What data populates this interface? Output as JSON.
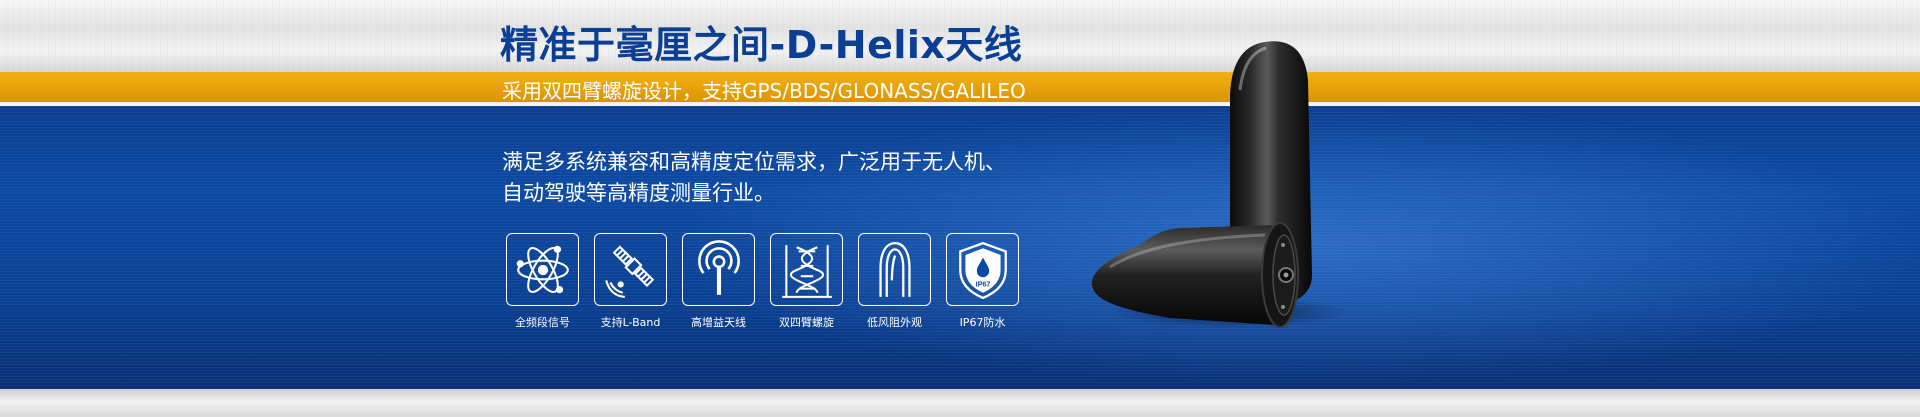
{
  "banner": {
    "title": "精准于毫厘之间-D-Helix天线",
    "subtitle": "采用双四臂螺旋设计，支持GPS/BDS/GLONASS/GALILEO",
    "description_lines": [
      "满足多系统兼容和高精度定位需求，广泛用于无人机、",
      "自动驾驶等高精度测量行业。"
    ],
    "features": [
      {
        "label": "全频段信号",
        "icon": "atom-icon"
      },
      {
        "label": "支持L-Band",
        "icon": "satellite-icon"
      },
      {
        "label": "高增益天线",
        "icon": "antenna-signal-icon"
      },
      {
        "label": "双四臂螺旋",
        "icon": "helix-icon"
      },
      {
        "label": "低风阻外观",
        "icon": "aerodynamic-icon"
      },
      {
        "label": "IP67防水",
        "icon": "waterproof-shield-icon",
        "badge": "IP67"
      }
    ],
    "colors": {
      "title_blue": "#0b3f95",
      "gold": "#e9a30a",
      "blue_bg": "#0c4aa3",
      "silver": "#e2e2e2"
    }
  }
}
